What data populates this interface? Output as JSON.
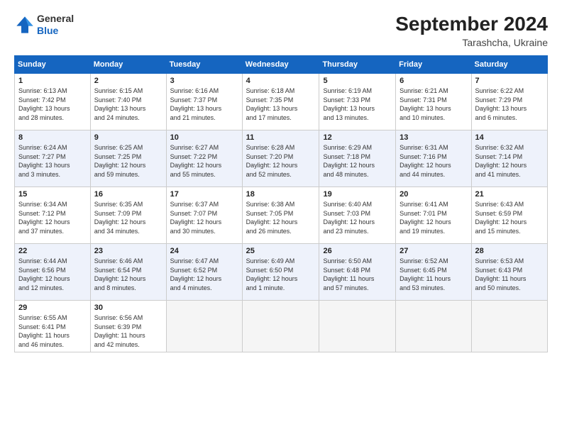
{
  "header": {
    "logo_line1": "General",
    "logo_line2": "Blue",
    "month_year": "September 2024",
    "location": "Tarashcha, Ukraine"
  },
  "weekdays": [
    "Sunday",
    "Monday",
    "Tuesday",
    "Wednesday",
    "Thursday",
    "Friday",
    "Saturday"
  ],
  "weeks": [
    [
      {
        "day": "1",
        "info": "Sunrise: 6:13 AM\nSunset: 7:42 PM\nDaylight: 13 hours\nand 28 minutes."
      },
      {
        "day": "2",
        "info": "Sunrise: 6:15 AM\nSunset: 7:40 PM\nDaylight: 13 hours\nand 24 minutes."
      },
      {
        "day": "3",
        "info": "Sunrise: 6:16 AM\nSunset: 7:37 PM\nDaylight: 13 hours\nand 21 minutes."
      },
      {
        "day": "4",
        "info": "Sunrise: 6:18 AM\nSunset: 7:35 PM\nDaylight: 13 hours\nand 17 minutes."
      },
      {
        "day": "5",
        "info": "Sunrise: 6:19 AM\nSunset: 7:33 PM\nDaylight: 13 hours\nand 13 minutes."
      },
      {
        "day": "6",
        "info": "Sunrise: 6:21 AM\nSunset: 7:31 PM\nDaylight: 13 hours\nand 10 minutes."
      },
      {
        "day": "7",
        "info": "Sunrise: 6:22 AM\nSunset: 7:29 PM\nDaylight: 13 hours\nand 6 minutes."
      }
    ],
    [
      {
        "day": "8",
        "info": "Sunrise: 6:24 AM\nSunset: 7:27 PM\nDaylight: 13 hours\nand 3 minutes."
      },
      {
        "day": "9",
        "info": "Sunrise: 6:25 AM\nSunset: 7:25 PM\nDaylight: 12 hours\nand 59 minutes."
      },
      {
        "day": "10",
        "info": "Sunrise: 6:27 AM\nSunset: 7:22 PM\nDaylight: 12 hours\nand 55 minutes."
      },
      {
        "day": "11",
        "info": "Sunrise: 6:28 AM\nSunset: 7:20 PM\nDaylight: 12 hours\nand 52 minutes."
      },
      {
        "day": "12",
        "info": "Sunrise: 6:29 AM\nSunset: 7:18 PM\nDaylight: 12 hours\nand 48 minutes."
      },
      {
        "day": "13",
        "info": "Sunrise: 6:31 AM\nSunset: 7:16 PM\nDaylight: 12 hours\nand 44 minutes."
      },
      {
        "day": "14",
        "info": "Sunrise: 6:32 AM\nSunset: 7:14 PM\nDaylight: 12 hours\nand 41 minutes."
      }
    ],
    [
      {
        "day": "15",
        "info": "Sunrise: 6:34 AM\nSunset: 7:12 PM\nDaylight: 12 hours\nand 37 minutes."
      },
      {
        "day": "16",
        "info": "Sunrise: 6:35 AM\nSunset: 7:09 PM\nDaylight: 12 hours\nand 34 minutes."
      },
      {
        "day": "17",
        "info": "Sunrise: 6:37 AM\nSunset: 7:07 PM\nDaylight: 12 hours\nand 30 minutes."
      },
      {
        "day": "18",
        "info": "Sunrise: 6:38 AM\nSunset: 7:05 PM\nDaylight: 12 hours\nand 26 minutes."
      },
      {
        "day": "19",
        "info": "Sunrise: 6:40 AM\nSunset: 7:03 PM\nDaylight: 12 hours\nand 23 minutes."
      },
      {
        "day": "20",
        "info": "Sunrise: 6:41 AM\nSunset: 7:01 PM\nDaylight: 12 hours\nand 19 minutes."
      },
      {
        "day": "21",
        "info": "Sunrise: 6:43 AM\nSunset: 6:59 PM\nDaylight: 12 hours\nand 15 minutes."
      }
    ],
    [
      {
        "day": "22",
        "info": "Sunrise: 6:44 AM\nSunset: 6:56 PM\nDaylight: 12 hours\nand 12 minutes."
      },
      {
        "day": "23",
        "info": "Sunrise: 6:46 AM\nSunset: 6:54 PM\nDaylight: 12 hours\nand 8 minutes."
      },
      {
        "day": "24",
        "info": "Sunrise: 6:47 AM\nSunset: 6:52 PM\nDaylight: 12 hours\nand 4 minutes."
      },
      {
        "day": "25",
        "info": "Sunrise: 6:49 AM\nSunset: 6:50 PM\nDaylight: 12 hours\nand 1 minute."
      },
      {
        "day": "26",
        "info": "Sunrise: 6:50 AM\nSunset: 6:48 PM\nDaylight: 11 hours\nand 57 minutes."
      },
      {
        "day": "27",
        "info": "Sunrise: 6:52 AM\nSunset: 6:45 PM\nDaylight: 11 hours\nand 53 minutes."
      },
      {
        "day": "28",
        "info": "Sunrise: 6:53 AM\nSunset: 6:43 PM\nDaylight: 11 hours\nand 50 minutes."
      }
    ],
    [
      {
        "day": "29",
        "info": "Sunrise: 6:55 AM\nSunset: 6:41 PM\nDaylight: 11 hours\nand 46 minutes."
      },
      {
        "day": "30",
        "info": "Sunrise: 6:56 AM\nSunset: 6:39 PM\nDaylight: 11 hours\nand 42 minutes."
      },
      {
        "day": "",
        "info": ""
      },
      {
        "day": "",
        "info": ""
      },
      {
        "day": "",
        "info": ""
      },
      {
        "day": "",
        "info": ""
      },
      {
        "day": "",
        "info": ""
      }
    ]
  ]
}
